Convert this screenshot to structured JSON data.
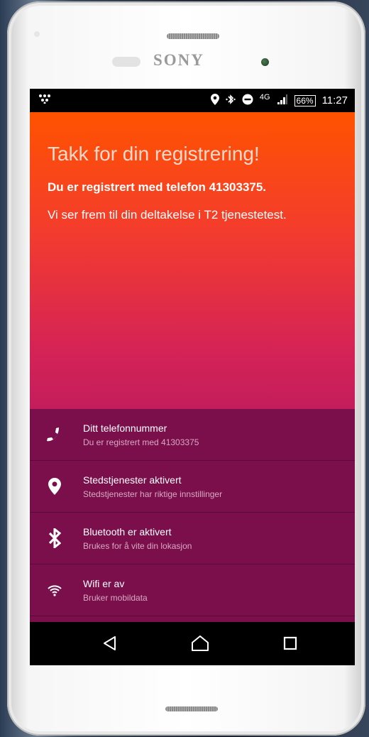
{
  "device": {
    "brand": "SONY"
  },
  "status_bar": {
    "network_type": "4G",
    "battery": "66%",
    "time": "11:27"
  },
  "main": {
    "title": "Takk for din registrering!",
    "registered": "Du er registrert med telefon 41303375.",
    "welcome": "Vi ser frem til din deltakelse i T2 tjenestetest."
  },
  "status_items": [
    {
      "title": "Ditt telefonnummer",
      "subtitle": "Du er registrert med 41303375",
      "icon": "phone-icon"
    },
    {
      "title": "Stedstjenester aktivert",
      "subtitle": "Stedstjenester har riktige innstillinger",
      "icon": "location-pin-icon"
    },
    {
      "title": "Bluetooth er aktivert",
      "subtitle": "Brukes for å vite din lokasjon",
      "icon": "bluetooth-icon"
    },
    {
      "title": "Wifi er av",
      "subtitle": "Bruker mobildata",
      "icon": "wifi-icon"
    }
  ],
  "colors": {
    "gradient_top": "#ff5300",
    "gradient_bottom": "#c41d5c",
    "list_background": "#7a0f4c"
  }
}
